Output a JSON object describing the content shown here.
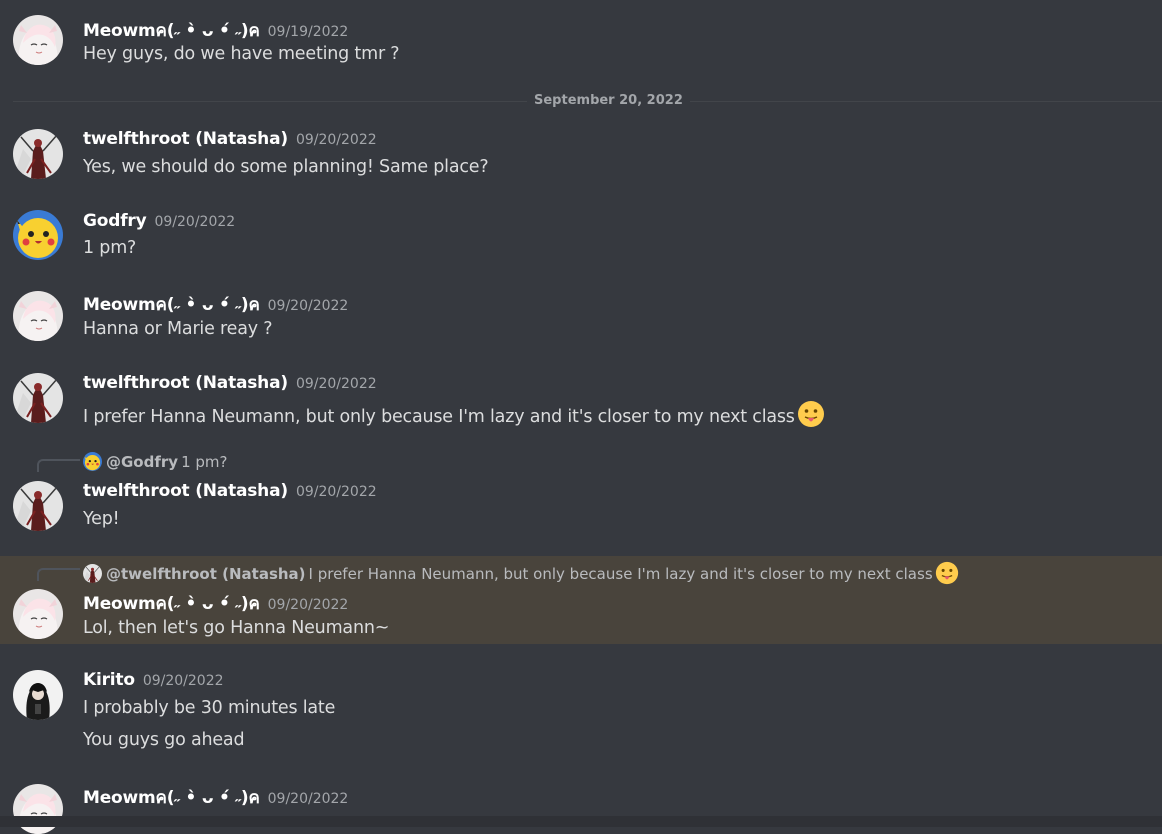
{
  "date_divider": "September 20, 2022",
  "messages": [
    {
      "user": "Meowmค(˶ •̀ ᴗ •́ ˶)ค",
      "time": "09/19/2022",
      "lines": [
        "Hey guys, do we have meeting tmr ?"
      ]
    },
    {
      "user": "twelfthroot (Natasha)",
      "time": "09/20/2022",
      "lines": [
        "Yes, we should do some planning! Same place?"
      ]
    },
    {
      "user": "Godfry",
      "time": "09/20/2022",
      "lines": [
        "1 pm?"
      ]
    },
    {
      "user": "Meowmค(˶ •̀ ᴗ •́ ˶)ค",
      "time": "09/20/2022",
      "lines": [
        "Hanna or Marie reay ?"
      ]
    },
    {
      "user": "twelfthroot (Natasha)",
      "time": "09/20/2022",
      "lines": [
        "I prefer Hanna Neumann, but only because I'm lazy and it's closer to my next class"
      ]
    },
    {
      "user": "twelfthroot (Natasha)",
      "time": "09/20/2022",
      "lines": [
        "Yep!"
      ],
      "reply": {
        "name": "@Godfry",
        "text": "1 pm?"
      }
    },
    {
      "user": "Meowmค(˶ •̀ ᴗ •́ ˶)ค",
      "time": "09/20/2022",
      "lines": [
        "Lol, then let's go Hanna Neumann~"
      ],
      "reply": {
        "name": "@twelfthroot (Natasha)",
        "text": "I prefer Hanna Neumann, but only because I'm lazy and it's closer to my next class"
      }
    },
    {
      "user": "Kirito",
      "time": "09/20/2022",
      "lines": [
        "I probably be 30 minutes late",
        "You guys go ahead"
      ]
    },
    {
      "user": "Meowmค(˶ •̀ ᴗ •́ ˶)ค",
      "time": "09/20/2022",
      "lines": []
    }
  ],
  "icons": {
    "tongue_emoji": "tongue-out-emoji",
    "reply_connector": "reply-connector"
  },
  "colors": {
    "background": "#36393f",
    "highlight": "#49443c",
    "username": "#ffffff",
    "timestamp": "#a3a6aa"
  }
}
